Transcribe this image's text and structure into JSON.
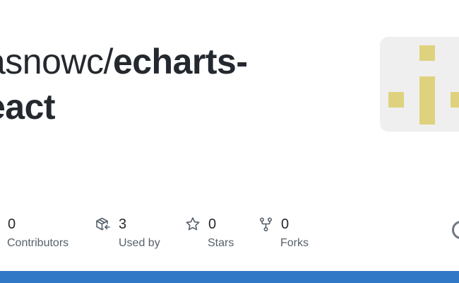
{
  "repo": {
    "owner": "asnowc/",
    "name_line1": "echarts-",
    "name_line2": "eact"
  },
  "stats": [
    {
      "icon": "people-icon",
      "count": "0",
      "label": "Contributors"
    },
    {
      "icon": "package-dependents-icon",
      "count": "3",
      "label": "Used by"
    },
    {
      "icon": "star-icon",
      "count": "0",
      "label": "Stars"
    },
    {
      "icon": "repo-forked-icon",
      "count": "0",
      "label": "Forks"
    }
  ],
  "colors": {
    "title": "#24292f",
    "label": "#57606a",
    "avatar_bg": "#efefef",
    "avatar_fg": "#dfd27e",
    "language_bar": "#3178c6"
  }
}
